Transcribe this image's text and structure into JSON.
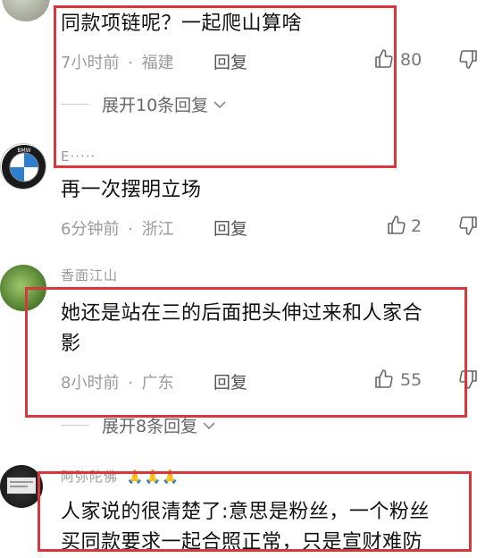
{
  "comments": [
    {
      "text": "同款项链呢？一起爬山算啥",
      "time": "7小时前",
      "location": "福建",
      "reply_label": "回复",
      "likes": "80",
      "expand_label": "展开10条回复"
    },
    {
      "username": "E·····",
      "avatar_text": "BMW",
      "text": "再一次摆明立场",
      "time": "6分钟前",
      "location": "浙江",
      "reply_label": "回复",
      "likes": "2"
    },
    {
      "username": "香面江山",
      "text_line1": "她还是站在三的后面把头伸过来和人家合",
      "text_line2": "影",
      "time": "8小时前",
      "location": "广东",
      "reply_label": "回复",
      "likes": "55",
      "expand_label": "展开8条回复"
    },
    {
      "username": "阿弥陀佛",
      "text_line1": "人家说的很清楚了:意思是粉丝，一个粉丝",
      "text_line2": "买同款要求一起合照正常，只是宣财难防"
    }
  ],
  "separator": "·",
  "colors": {
    "highlight_box": "#d9363e",
    "meta_text": "#9a9a9a"
  }
}
